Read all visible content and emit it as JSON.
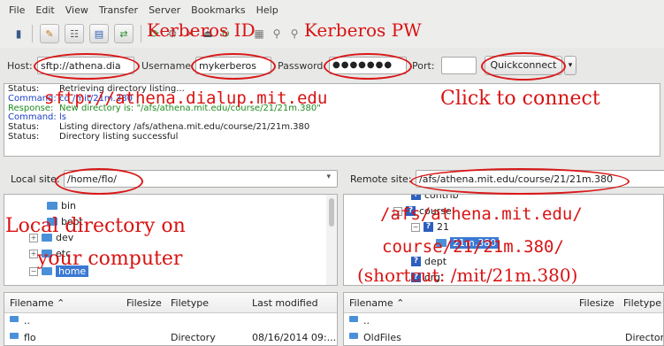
{
  "menu": [
    "File",
    "Edit",
    "View",
    "Transfer",
    "Server",
    "Bookmarks",
    "Help"
  ],
  "quickconnect": {
    "host_label": "Host:",
    "host_value": "sftp://athena.dia",
    "username_label": "Username:",
    "username_value": "mykerberos",
    "password_label": "Password:",
    "password_value": "●●●●●●●",
    "port_label": "Port:",
    "port_value": "",
    "button": "Quickconnect",
    "dropdown": "▾"
  },
  "log": [
    {
      "type": "Status:",
      "text": "Retrieving directory listing...",
      "color": "#222222"
    },
    {
      "type": "Command:",
      "text": "cd /mit/21m.380",
      "color": "#1a3fc4"
    },
    {
      "type": "Response:",
      "text": "New directory is: \"/afs/athena.mit.edu/course/21/21m.380\"",
      "color": "#1e8a1e"
    },
    {
      "type": "Command:",
      "text": "ls",
      "color": "#1a3fc4"
    },
    {
      "type": "Status:",
      "text": "Listing directory /afs/athena.mit.edu/course/21/21m.380",
      "color": "#222222"
    },
    {
      "type": "Status:",
      "text": "Directory listing successful",
      "color": "#222222"
    }
  ],
  "local": {
    "site_label": "Local site:",
    "site_path": "/home/flo/",
    "tree": [
      "bin",
      "boot",
      "dev",
      "etc",
      "home"
    ],
    "columns": [
      "Filename ⌃",
      "Filesize",
      "Filetype",
      "Last modified"
    ],
    "rows": [
      {
        "name": "..",
        "size": "",
        "type": "",
        "modified": ""
      },
      {
        "name": "flo",
        "size": "",
        "type": "Directory",
        "modified": "08/16/2014 09:..."
      }
    ]
  },
  "remote": {
    "site_label": "Remote site:",
    "site_path": "/afs/athena.mit.edu/course/21/21m.380",
    "tree": [
      "contrib",
      "course",
      "21",
      "21m.380",
      "dept",
      "org"
    ],
    "columns": [
      "Filename ⌃",
      "Filesize",
      "Filetype"
    ],
    "rows": [
      {
        "name": "..",
        "size": "",
        "type": ""
      },
      {
        "name": "OldFiles",
        "size": "",
        "type": "Director"
      }
    ]
  },
  "annotations": {
    "kerberos_id": "Kerberos ID",
    "kerberos_pw": "Kerberos PW",
    "host": "athena.dialup.mit.edu",
    "host_prefix": "sftp://",
    "click": "Click to connect",
    "local1": "Local directory on",
    "local2": "your computer",
    "remote1": "/afs/athena.mit.edu/",
    "remote2": "course/21/21m.380/",
    "remote3": "(shortcut: /mit/21m.380)"
  },
  "colors": {
    "annotation": "#d81313",
    "selection": "#3a78d4"
  }
}
